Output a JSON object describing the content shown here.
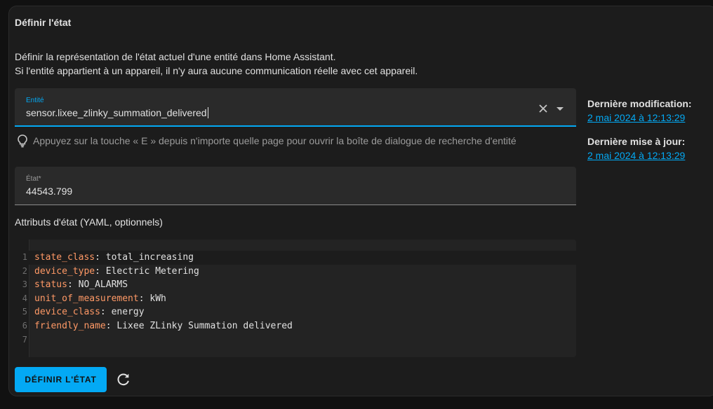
{
  "card": {
    "title": "Définir l'état",
    "description_line1": "Définir la représentation de l'état actuel d'une entité dans Home Assistant.",
    "description_line2": "Si l'entité appartient à un appareil, il n'y aura aucune communication réelle avec cet appareil."
  },
  "entity_field": {
    "label": "Entité",
    "value": "sensor.lixee_zlinky_summation_delivered",
    "clear_icon": "close-icon",
    "dropdown_icon": "chevron-down-icon"
  },
  "hint": {
    "icon": "lightbulb-icon",
    "text": "Appuyez sur la touche « E » depuis n'importe quelle page pour ouvrir la boîte de dialogue de recherche d'entité"
  },
  "side": {
    "last_changed_label": "Dernière modification:",
    "last_changed_value": "2 mai 2024 à 12:13:29",
    "last_updated_label": "Dernière mise à jour:",
    "last_updated_value": "2 mai 2024 à 12:13:29"
  },
  "state_field": {
    "label": "État*",
    "value": "44543.799"
  },
  "attributes": {
    "title": "Attributs d'état (YAML, optionnels)",
    "lines": [
      {
        "num": "1",
        "key": "state_class",
        "sep": ": ",
        "value": "total_increasing"
      },
      {
        "num": "2",
        "key": "device_type",
        "sep": ": ",
        "value": "Electric Metering"
      },
      {
        "num": "3",
        "key": "status",
        "sep": ": ",
        "value": "NO_ALARMS"
      },
      {
        "num": "4",
        "key": "unit_of_measurement",
        "sep": ": ",
        "value": "kWh"
      },
      {
        "num": "5",
        "key": "device_class",
        "sep": ": ",
        "value": "energy"
      },
      {
        "num": "6",
        "key": "friendly_name",
        "sep": ": ",
        "value": "Lixee ZLinky Summation delivered"
      },
      {
        "num": "7",
        "key": "",
        "sep": "",
        "value": ""
      }
    ]
  },
  "actions": {
    "set_state_label": "DÉFINIR L'ÉTAT",
    "refresh_icon": "refresh-icon"
  },
  "colors": {
    "accent": "#03a9f4",
    "yaml_key": "#ff9966",
    "background": "#1c1c1c"
  }
}
